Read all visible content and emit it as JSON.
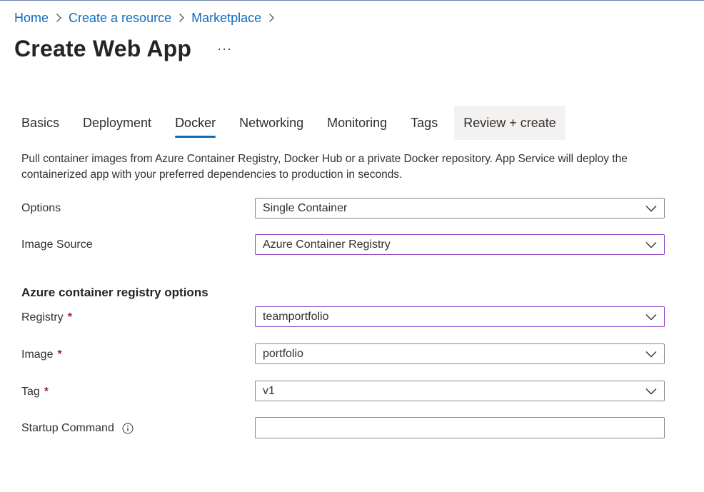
{
  "breadcrumb": {
    "items": [
      "Home",
      "Create a resource",
      "Marketplace"
    ]
  },
  "page": {
    "title": "Create Web App",
    "more_label": "···"
  },
  "tabs": [
    {
      "label": "Basics",
      "active": false
    },
    {
      "label": "Deployment",
      "active": false
    },
    {
      "label": "Docker",
      "active": true
    },
    {
      "label": "Networking",
      "active": false
    },
    {
      "label": "Monitoring",
      "active": false
    },
    {
      "label": "Tags",
      "active": false
    },
    {
      "label": "Review + create",
      "active": false
    }
  ],
  "description": "Pull container images from Azure Container Registry, Docker Hub or a private Docker repository. App Service will deploy the containerized app with your preferred dependencies to production in seconds.",
  "form": {
    "options": {
      "label": "Options",
      "value": "Single Container"
    },
    "image_source": {
      "label": "Image Source",
      "value": "Azure Container Registry"
    },
    "section_heading": "Azure container registry options",
    "registry": {
      "label": "Registry",
      "required_mark": "*",
      "value": "teamportfolio"
    },
    "image": {
      "label": "Image",
      "required_mark": "*",
      "value": "portfolio"
    },
    "tag": {
      "label": "Tag",
      "required_mark": "*",
      "value": "v1"
    },
    "startup_command": {
      "label": "Startup Command",
      "value": ""
    }
  },
  "colors": {
    "link": "#0f6cbd",
    "active_tab_underline": "#0f6cbd",
    "focused_border": "#8c3fc4",
    "required": "#a4262c"
  },
  "icons": {
    "breadcrumb_separator": "chevron-right-icon",
    "dropdown": "chevron-down-icon",
    "info": "info-icon"
  }
}
